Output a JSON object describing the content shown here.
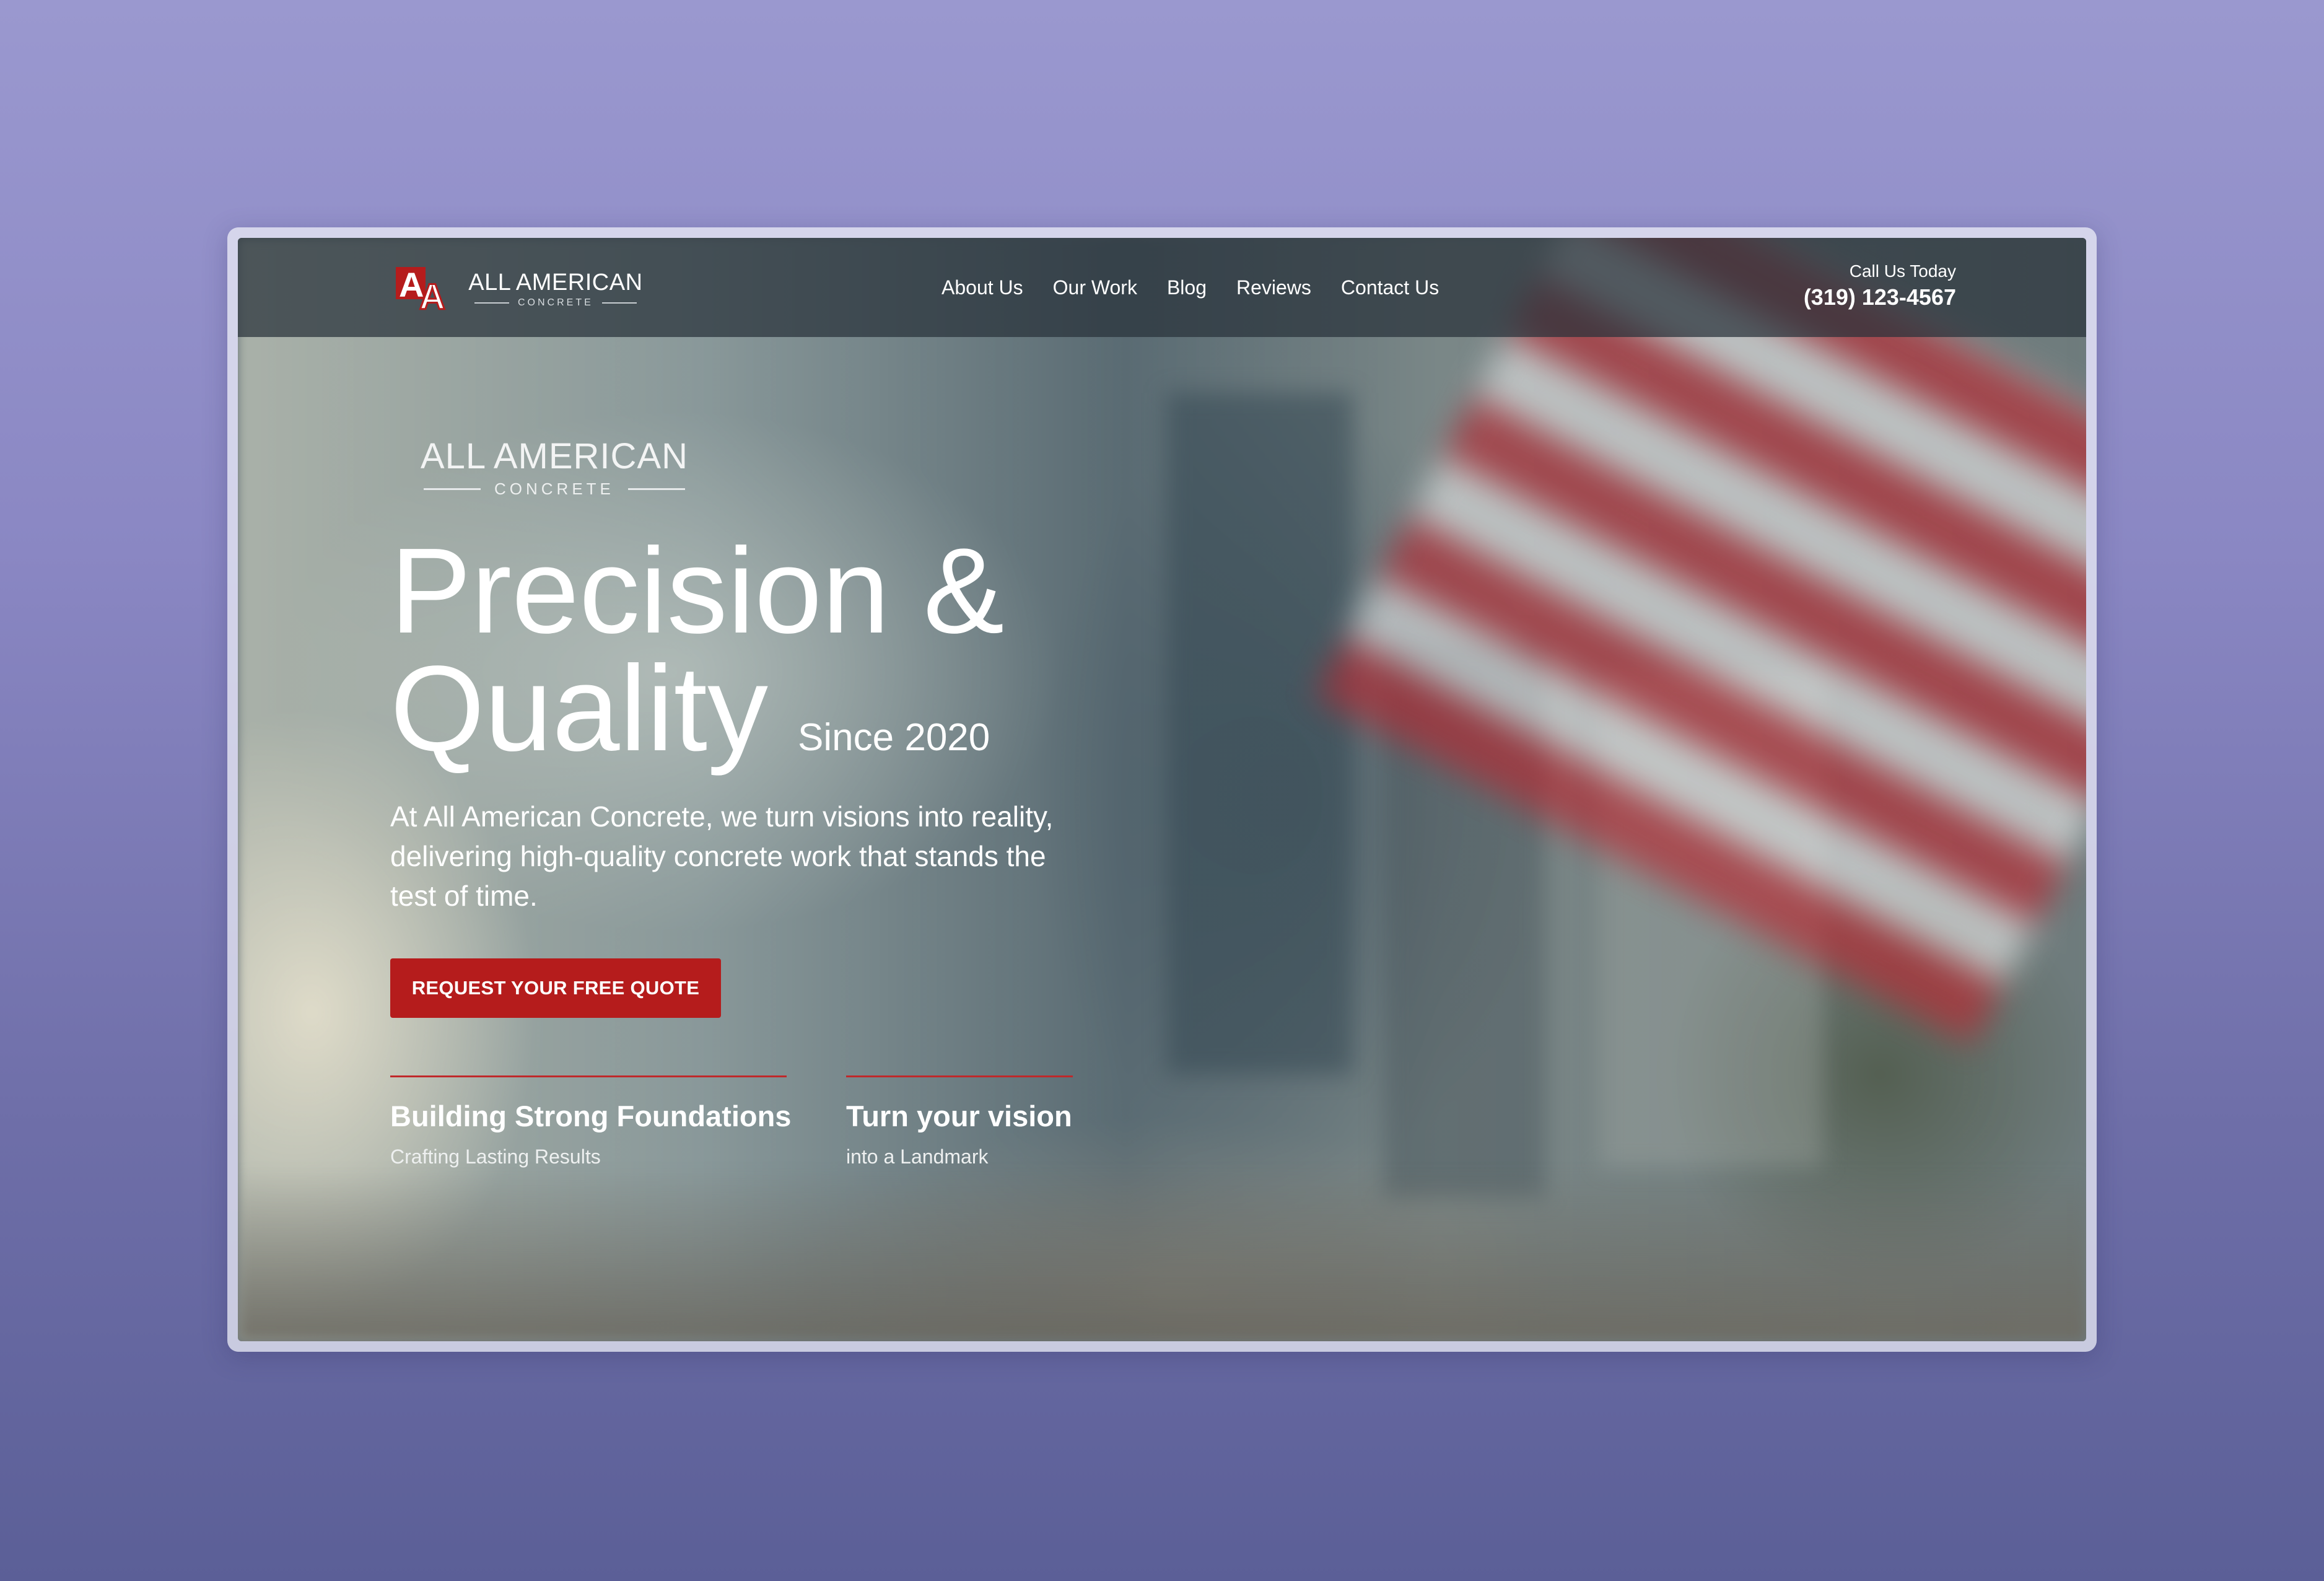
{
  "brand": {
    "name": "ALL AMERICAN",
    "sub": "CONCRETE",
    "colors": {
      "accent": "#b51c1c"
    }
  },
  "nav": {
    "items": [
      "About Us",
      "Our Work",
      "Blog",
      "Reviews",
      "Contact Us"
    ]
  },
  "call": {
    "label": "Call Us Today",
    "phone": "(319) 123-4567"
  },
  "hero": {
    "brand_title": "ALL AMERICAN",
    "brand_sub": "CONCRETE",
    "headline_line1": "Precision &",
    "headline_line2": "Quality",
    "since": "Since 2020",
    "intro": "At All American Concrete, we turn visions into reality, delivering high-quality concrete work that stands the test of time.",
    "cta": "REQUEST YOUR FREE QUOTE"
  },
  "features": [
    {
      "title": "Building Strong Foundations",
      "sub": "Crafting Lasting Results"
    },
    {
      "title": "Turn your vision",
      "sub": "into a Landmark"
    }
  ]
}
